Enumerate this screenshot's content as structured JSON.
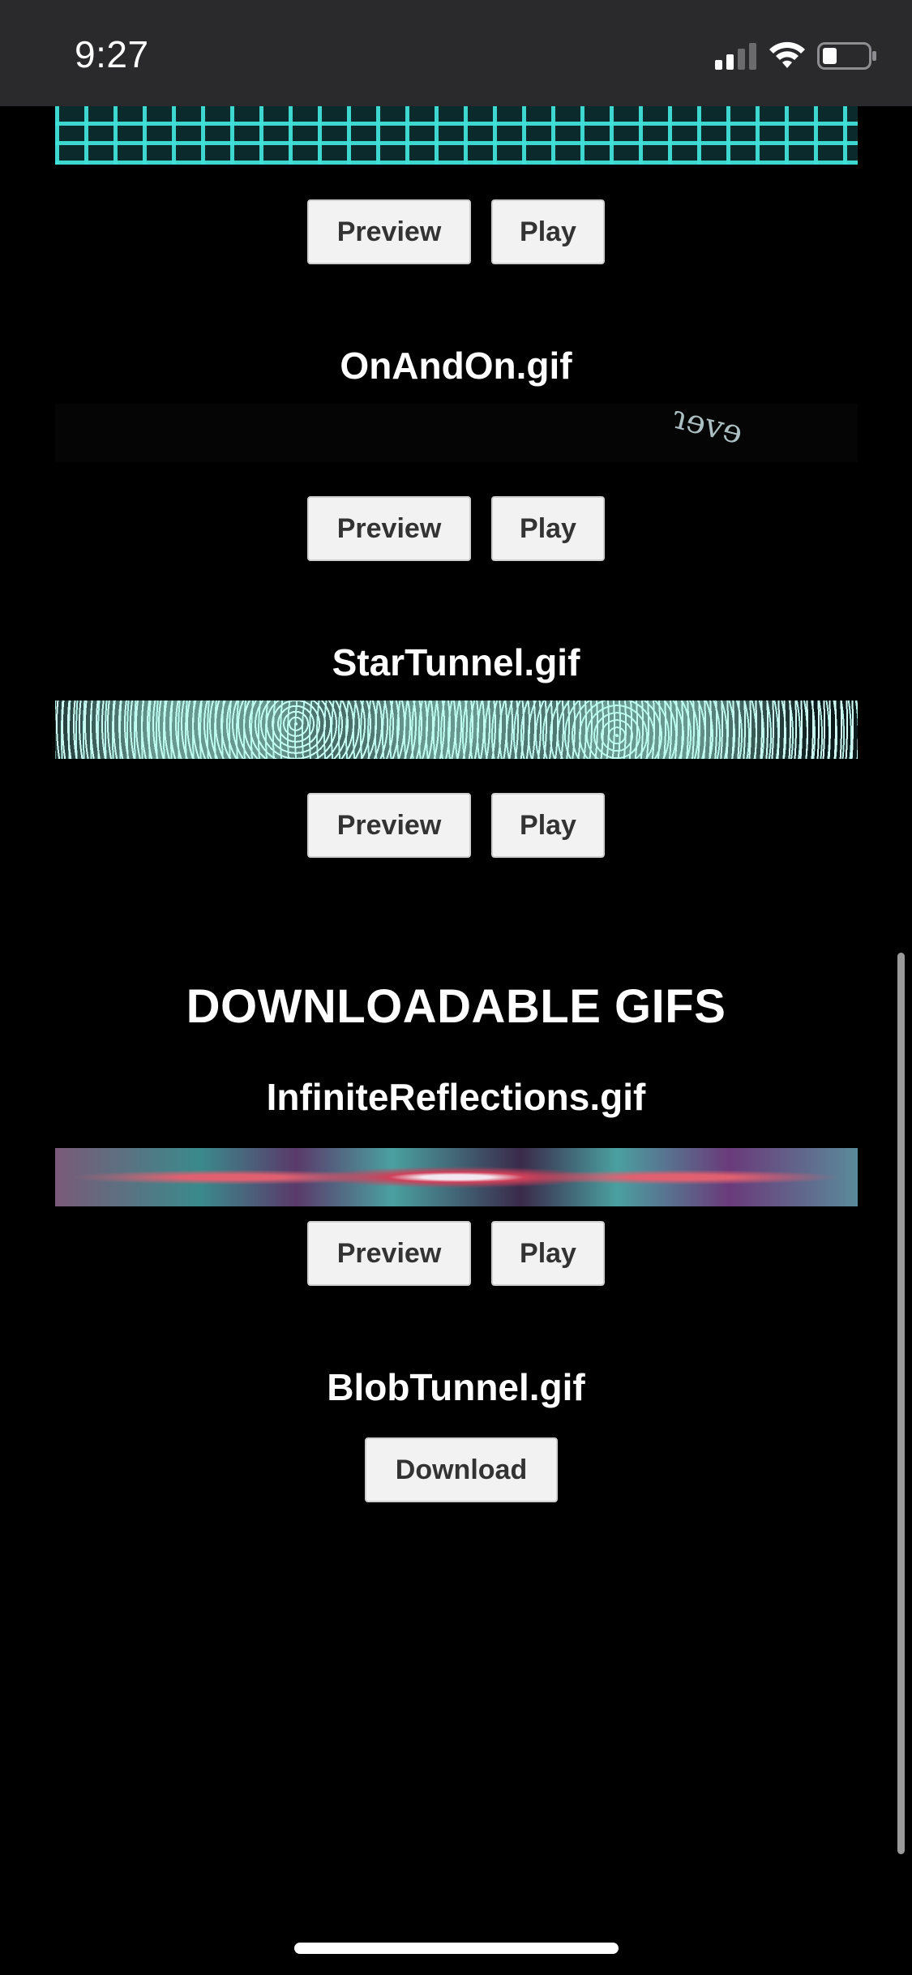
{
  "status_bar": {
    "time": "9:27",
    "signal_icon": "cellular-signal-icon",
    "wifi_icon": "wifi-icon",
    "battery_icon": "battery-icon"
  },
  "gifs": [
    {
      "title": "",
      "preview_label": "Preview",
      "play_label": "Play"
    },
    {
      "title": "OnAndOn.gif",
      "preview_label": "Preview",
      "play_label": "Play"
    },
    {
      "title": "StarTunnel.gif",
      "preview_label": "Preview",
      "play_label": "Play"
    }
  ],
  "downloadable": {
    "heading": "DOWNLOADABLE GIFS",
    "items": [
      {
        "title": "InfiniteReflections.gif",
        "preview_label": "Preview",
        "play_label": "Play"
      },
      {
        "title": "BlobTunnel.gif",
        "download_label": "Download"
      }
    ]
  },
  "colors": {
    "background": "#000000",
    "status_bar": "#2a2a2c",
    "button_bg": "#f2f2f2",
    "button_text": "#333333",
    "title_text": "#ffffff"
  }
}
